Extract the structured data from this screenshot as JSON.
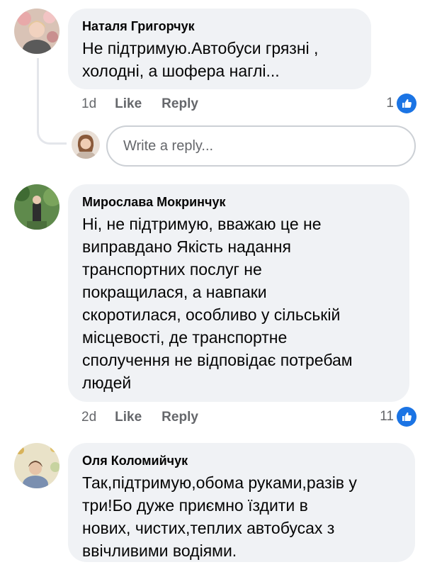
{
  "comments": [
    {
      "author": "Наталя Григорчук",
      "text": "Не підтримую.Автобуси грязні ,\nхолодні, а шофера наглі...",
      "time": "1d",
      "like_label": "Like",
      "reply_label": "Reply",
      "reaction_count": "1"
    },
    {
      "author": "Мирослава Мокринчук",
      "text": "Ні, не підтримую, вважаю це не\nвиправдано Якість надання\nтранспортних послуг не\nпокращилася, а навпаки\nскоротилася, особливо у сільській\nмісцевості, де транспортне\nсполучення не відповідає потребам\nлюдей",
      "time": "2d",
      "like_label": "Like",
      "reply_label": "Reply",
      "reaction_count": "11"
    },
    {
      "author": "Оля Коломийчук",
      "text": "Так,підтримую,обома руками,разів у\nтри!Бо дуже приємно їздити в\nнових, чистих,теплих автобусах з\nввічливими водіями."
    }
  ],
  "reply_box": {
    "placeholder": "Write a reply..."
  },
  "icons": {
    "like": "thumbs-up-icon"
  },
  "colors": {
    "bubble": "#f0f2f5",
    "like_blue": "#1b74e4",
    "secondary_text": "#65676b"
  }
}
